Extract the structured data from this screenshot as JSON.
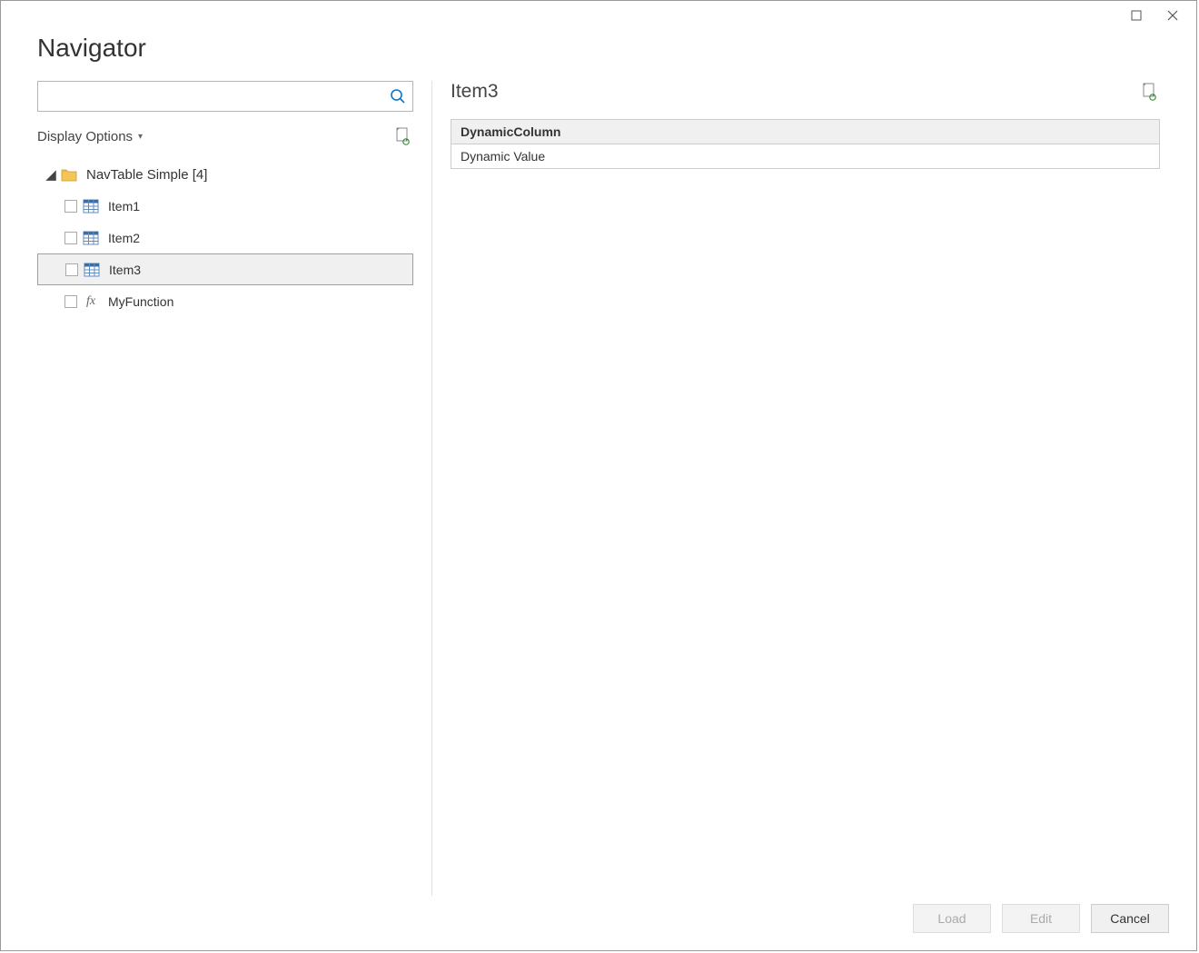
{
  "title": "Navigator",
  "search": {
    "placeholder": ""
  },
  "display_options_label": "Display Options",
  "tree": {
    "root_label": "NavTable Simple [4]",
    "items": [
      {
        "label": "Item1",
        "type": "table",
        "selected": false
      },
      {
        "label": "Item2",
        "type": "table",
        "selected": false
      },
      {
        "label": "Item3",
        "type": "table",
        "selected": true
      },
      {
        "label": "MyFunction",
        "type": "function",
        "selected": false
      }
    ]
  },
  "preview": {
    "title": "Item3",
    "columns": [
      "DynamicColumn"
    ],
    "rows": [
      [
        "Dynamic Value"
      ]
    ]
  },
  "footer": {
    "load_label": "Load",
    "edit_label": "Edit",
    "cancel_label": "Cancel"
  }
}
